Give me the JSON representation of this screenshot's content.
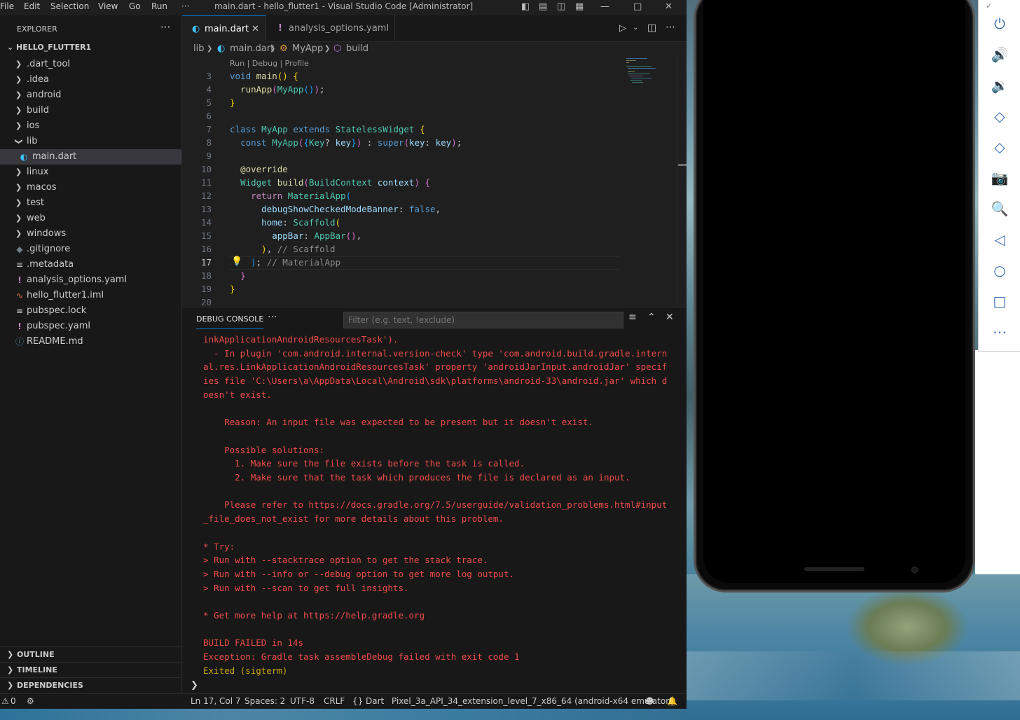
{
  "window": {
    "menu": [
      "File",
      "Edit",
      "Selection",
      "View",
      "Go",
      "Run",
      "···"
    ],
    "title": "main.dart - hello_flutter1 - Visual Studio Code [Administrator]"
  },
  "explorer": {
    "header": "EXPLORER",
    "dots": "···",
    "project": "HELLO_FLUTTER1",
    "items": [
      {
        "label": ".dart_tool"
      },
      {
        "label": ".idea"
      },
      {
        "label": "android"
      },
      {
        "label": "build"
      },
      {
        "label": "ios"
      },
      {
        "label": "lib"
      },
      {
        "label": "main.dart"
      },
      {
        "label": "linux"
      },
      {
        "label": "macos"
      },
      {
        "label": "test"
      },
      {
        "label": "web"
      },
      {
        "label": "windows"
      },
      {
        "label": ".gitignore"
      },
      {
        "label": ".metadata"
      },
      {
        "label": "analysis_options.yaml"
      },
      {
        "label": "hello_flutter1.iml"
      },
      {
        "label": "pubspec.lock"
      },
      {
        "label": "pubspec.yaml"
      },
      {
        "label": "README.md"
      }
    ],
    "sections": [
      "OUTLINE",
      "TIMELINE",
      "DEPENDENCIES"
    ]
  },
  "tabs": [
    {
      "label": "main.dart"
    },
    {
      "label": "analysis_options.yaml"
    }
  ],
  "breadcrumb": {
    "a": "lib",
    "b": "main.dart",
    "c": "MyApp",
    "d": "build"
  },
  "codelens": "Run | Debug | Profile",
  "line_numbers": [
    "3",
    "4",
    "5",
    "6",
    "7",
    "8",
    "9",
    "10",
    "11",
    "12",
    "13",
    "14",
    "15",
    "16",
    "17",
    "18",
    "19",
    "20"
  ],
  "panel": {
    "tab": "DEBUG CONSOLE",
    "dots": "···",
    "filter_placeholder": "Filter (e.g. text, !exclude)",
    "lines": [
      "inkApplicationAndroidResourcesTask').",
      "  - In plugin 'com.android.internal.version-check' type 'com.android.build.gradle.intern",
      "al.res.LinkApplicationAndroidResourcesTask' property 'androidJarInput.androidJar' specif",
      "ies file 'C:\\Users\\a\\AppData\\Local\\Android\\sdk\\platforms\\android-33\\android.jar' which d",
      "oesn't exist.",
      "",
      "    Reason: An input file was expected to be present but it doesn't exist.",
      "",
      "    Possible solutions:",
      "      1. Make sure the file exists before the task is called.",
      "      2. Make sure that the task which produces the file is declared as an input.",
      "",
      "    Please refer to https://docs.gradle.org/7.5/userguide/validation_problems.html#input",
      "_file_does_not_exist for more details about this problem.",
      "",
      "* Try:",
      "> Run with --stacktrace option to get the stack trace.",
      "> Run with --info or --debug option to get more log output.",
      "> Run with --scan to get full insights.",
      "",
      "* Get more help at https://help.gradle.org",
      "",
      "BUILD FAILED in 14s",
      "Exception: Gradle task assembleDebug failed with exit code 1",
      "Exited (sigterm)"
    ]
  },
  "status": {
    "problems": "0",
    "position": "Ln 17, Col 7",
    "spaces": "Spaces: 2",
    "encoding": "UTF-8",
    "eol": "CRLF",
    "language": "Dart",
    "device": "Pixel_3a_API_34_extension_level_7_x86_64 (android-x64 emulator)"
  },
  "colors": {
    "accent": "#0078d4",
    "error_text": "#f14c4c",
    "exited_text": "#cca700",
    "emulator_icon": "#3c6fb6"
  }
}
